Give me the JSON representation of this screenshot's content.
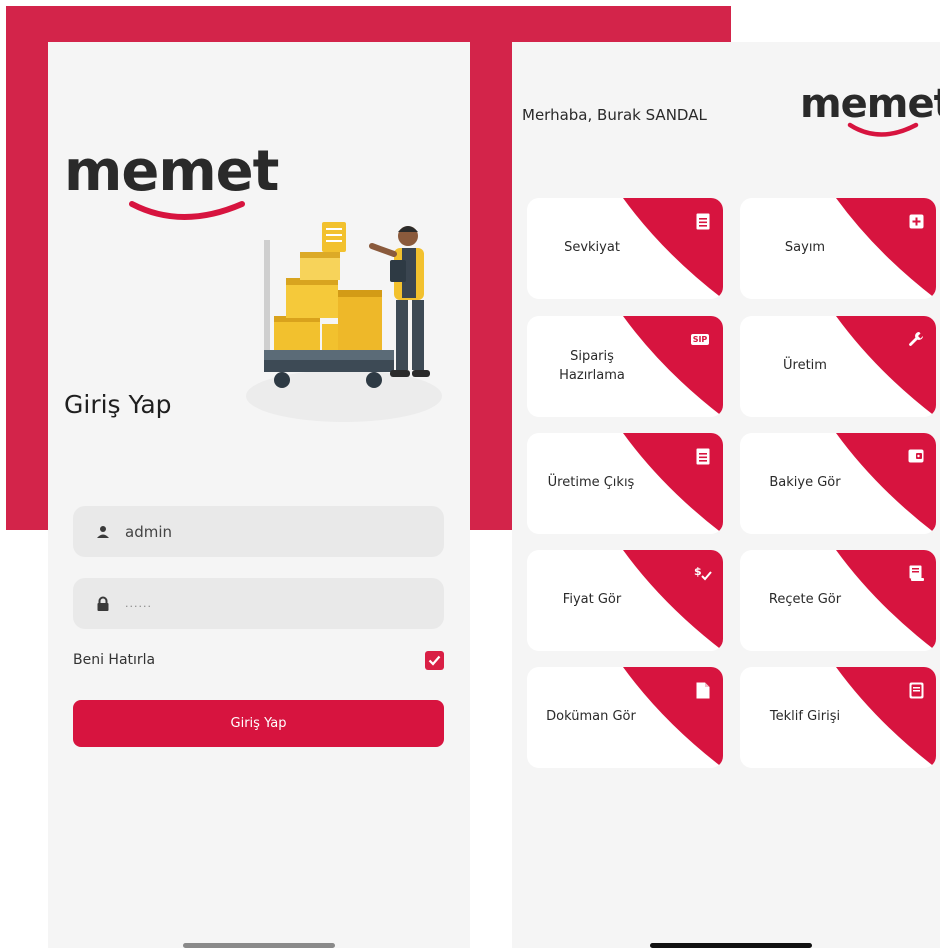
{
  "brand": {
    "name": "memet",
    "accent": "#d7143f",
    "background": "#d3244a"
  },
  "login": {
    "title": "Giriş Yap",
    "username_value": "admin",
    "password_value": "......",
    "remember_label": "Beni Hatırla",
    "remember_checked": true,
    "submit_label": "Giriş Yap",
    "user_icon": "user-icon",
    "lock_icon": "lock-icon"
  },
  "home": {
    "greeting": "Merhaba, Burak SANDAL",
    "tiles": [
      {
        "label": "Sevkiyat",
        "icon": "receipt-icon"
      },
      {
        "label": "Sayım",
        "icon": "plus-box-icon"
      },
      {
        "label": "Sipariş Hazırlama",
        "icon": "sip-badge-icon",
        "badge": "SIP"
      },
      {
        "label": "Üretim",
        "icon": "wrench-icon"
      },
      {
        "label": "Üretime Çıkış",
        "icon": "receipt-icon"
      },
      {
        "label": "Bakiye Gör",
        "icon": "wallet-icon"
      },
      {
        "label": "Fiyat Gör",
        "icon": "price-check-icon"
      },
      {
        "label": "Reçete Gör",
        "icon": "recipe-icon"
      },
      {
        "label": "Doküman Gör",
        "icon": "document-icon"
      },
      {
        "label": "Teklif Girişi",
        "icon": "quote-icon"
      }
    ]
  }
}
